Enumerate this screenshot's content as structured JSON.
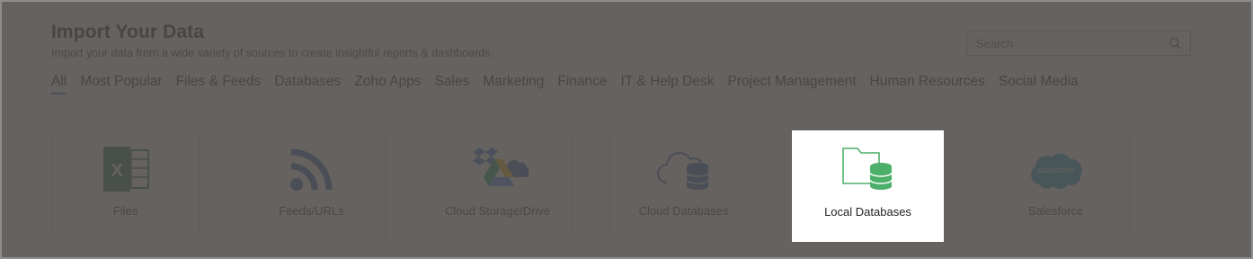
{
  "header": {
    "title": "Import Your Data",
    "subtitle": "Import your data from a wide variety of sources to create insightful reports & dashboards."
  },
  "search": {
    "placeholder": "Search",
    "icon": "search-icon"
  },
  "tabs": [
    {
      "label": "All",
      "active": true
    },
    {
      "label": "Most Popular"
    },
    {
      "label": "Files & Feeds"
    },
    {
      "label": "Databases"
    },
    {
      "label": "Zoho Apps"
    },
    {
      "label": "Sales"
    },
    {
      "label": "Marketing"
    },
    {
      "label": "Finance"
    },
    {
      "label": "IT & Help Desk"
    },
    {
      "label": "Project Management"
    },
    {
      "label": "Human Resources"
    },
    {
      "label": "Social Media"
    }
  ],
  "cards": [
    {
      "label": "Files",
      "icon": "excel-icon"
    },
    {
      "label": "Feeds/URLs",
      "icon": "rss-feed-icon"
    },
    {
      "label": "Cloud Storage/Drive",
      "icon": "cloud-storage-icon"
    },
    {
      "label": "Cloud Databases",
      "icon": "cloud-database-icon"
    },
    {
      "label": "Local Databases",
      "icon": "local-database-icon",
      "highlighted": true
    },
    {
      "label": "Salesforce",
      "icon": "salesforce-icon"
    }
  ],
  "colors": {
    "overlay": "#504c4a",
    "active_tab_underline": "#2b6fd6",
    "excel_green": "#1d6f42",
    "feed_blue": "#2a5ea8",
    "db_green": "#4caf6a",
    "salesforce_blue": "#1798c1"
  }
}
